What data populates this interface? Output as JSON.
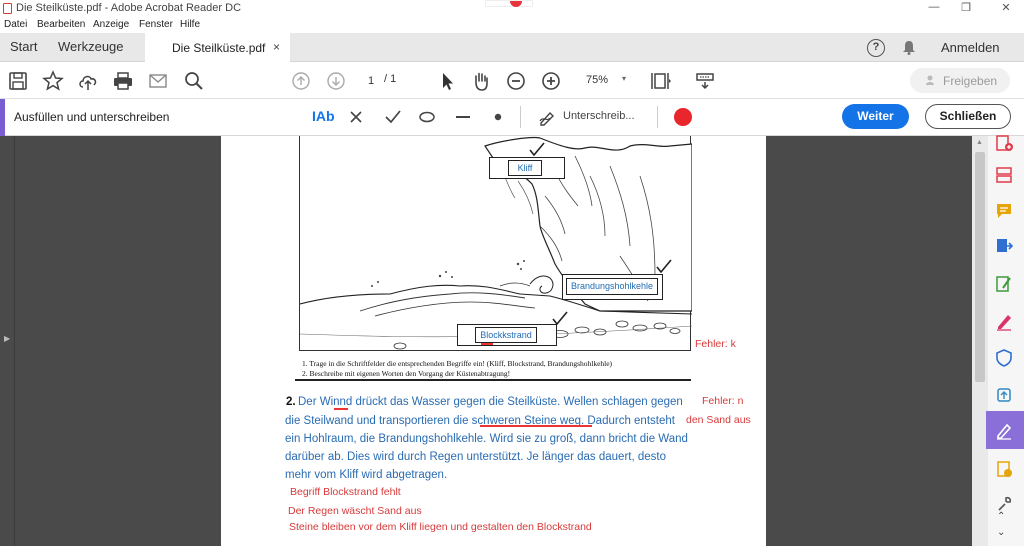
{
  "window": {
    "title": "Die Steilküste.pdf - Adobe Acrobat Reader DC"
  },
  "menu": [
    "Datei",
    "Bearbeiten",
    "Anzeige",
    "Fenster",
    "Hilfe"
  ],
  "tabs": {
    "start": "Start",
    "tools": "Werkzeuge",
    "document": "Die Steilküste.pdf",
    "close_glyph": "×"
  },
  "header": {
    "help_glyph": "?",
    "signin": "Anmelden"
  },
  "toolbar": {
    "page_current": "1",
    "page_total": "/ 1",
    "zoom": "75%",
    "zoom_caret": "▾",
    "share": "Freigeben"
  },
  "fillsign": {
    "title": "Ausfüllen und unterschreiben",
    "text_tool": "IAb",
    "sign_label": "Unterschreib...",
    "active_color": "#e8262c",
    "next": "Weiter",
    "close": "Schließen"
  },
  "figure": {
    "labels": {
      "cliff": "Kliff",
      "notch": "Brandungshohlkehle",
      "beach": "Blockkstrand"
    },
    "captions": [
      "1. Trage in die Schriftfelder die entsprechenden Begriffe ein! (Kliff, Blockstrand, Brandungshohlkehle)",
      "2. Beschreibe mit eigenen Worten den Vorgang der Küstenabtragung!"
    ]
  },
  "answer": {
    "number": "2.",
    "lines": [
      "Der Winnd drückt das Wasser gegen die Steilküste. Wellen schlagen gegen",
      "die Steilwand und transportieren die schweren Steine weg. Dadurch entsteht",
      "ein Hohlraum, die Brandungshohlkehle. Wird sie zu groß, dann bricht die Wand",
      "darüber ab. Dies wird durch Regen unterstützt. Je länger das dauert, desto",
      "mehr vom Kliff wird abgetragen."
    ]
  },
  "corrections": {
    "error_k": "Fehler: k",
    "error_n": "Fehler: n",
    "sand": "den Sand aus",
    "missing_term": "Begriff Blockstrand fehlt",
    "rain": "Der Regen wäscht Sand aus",
    "stones": "Steine bleiben vor dem Kliff liegen und gestalten den Blockstrand"
  },
  "right_panel": {
    "icons": [
      "create-pdf-icon",
      "organize-pages-icon",
      "comment-icon",
      "export-pdf-icon",
      "edit-pdf-icon",
      "fill-sign-pen-icon",
      "protect-icon",
      "convert-icon",
      "fill-and-sign-icon",
      "more-tools-icon",
      "wrench-icon"
    ],
    "colors": {
      "red": "#e03c4b",
      "yellow": "#e5a50a",
      "blue": "#2f6fd1",
      "green": "#3d9a3a",
      "pink": "#d9336b",
      "purple": "#8b6fd9"
    }
  }
}
